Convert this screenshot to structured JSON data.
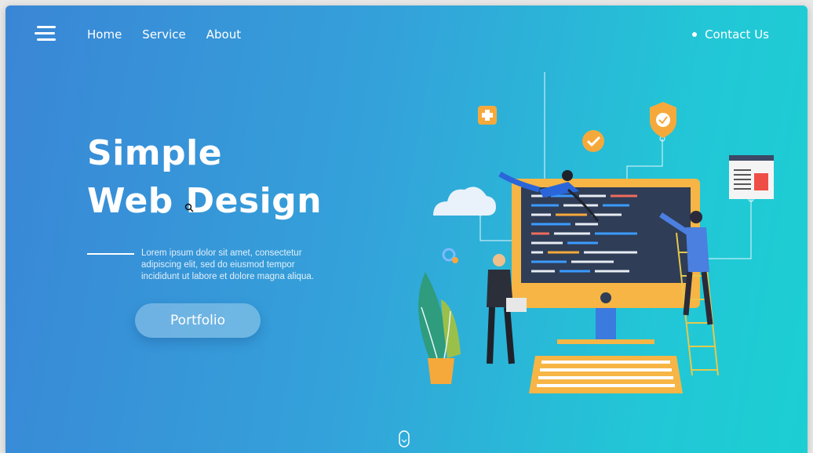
{
  "nav": {
    "items": [
      {
        "label": "Home"
      },
      {
        "label": "Service"
      },
      {
        "label": "About"
      }
    ],
    "contact_label": "Contact Us"
  },
  "hero": {
    "title_line1": "Simple",
    "title_line2": "Web Design",
    "lead": "Lorem ipsum dolor sit amet, consectetur adipiscing elit, sed do eiusmod tempor incididunt ut labore et dolore magna aliqua.",
    "button_label": "Portfolio"
  },
  "colors": {
    "gradient_start": "#3a86d6",
    "gradient_end": "#1ccfd3",
    "accent_orange": "#f6a93b",
    "screen_dark": "#2f3d57"
  },
  "icons": [
    "menu-icon",
    "mouse-scroll-icon",
    "zoom-cursor-icon"
  ]
}
